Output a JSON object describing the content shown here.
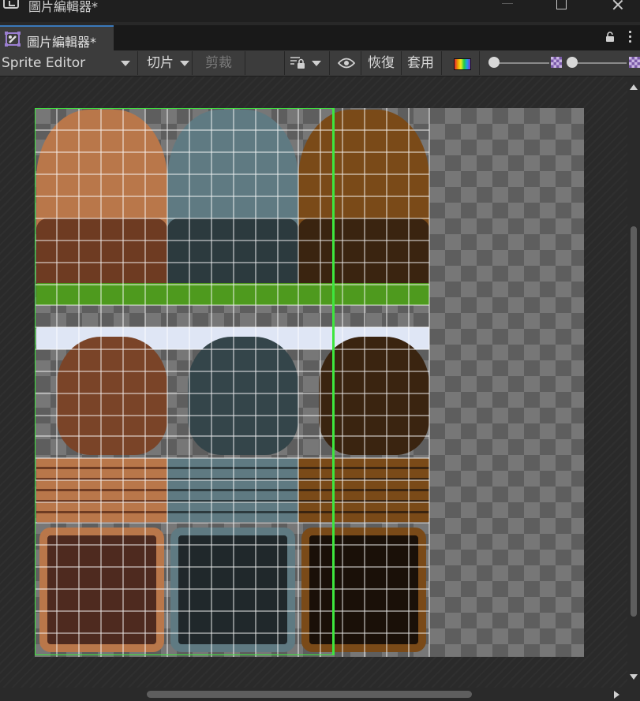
{
  "window": {
    "title": "圖片編輯器*",
    "icons": [
      "unity-app-icon",
      "minimize-icon",
      "maximize-icon",
      "close-icon"
    ]
  },
  "tab": {
    "label": "圖片編輯器*",
    "icons": [
      "sprite-editor-icon",
      "lock-icon",
      "menu-dots-icon"
    ],
    "accent_color": "#3a79bb"
  },
  "toolbar": {
    "mode_dropdown": "Sprite Editor",
    "slice_dropdown": "切片",
    "trim_button": "剪裁",
    "revert_button": "恢復",
    "apply_button": "套用",
    "icons": [
      "pivot-icon",
      "eye-icon",
      "rgb-color-icon",
      "zoom-slider",
      "alpha-checker-icon",
      "mip-slider"
    ]
  },
  "canvas": {
    "selection_color": "#3ee63e",
    "grid_color": "#ffffff",
    "tile_colors": {
      "brown": "#b9774a",
      "brown_dark": "#6e3b22",
      "slate": "#5f7a82",
      "slate_dark": "#2c3a3e",
      "dark_brown": "#7a4a18",
      "dark_brown_dark": "#3a2410",
      "grass": "#4e9a1e",
      "snow": "#dfe6f5"
    }
  }
}
